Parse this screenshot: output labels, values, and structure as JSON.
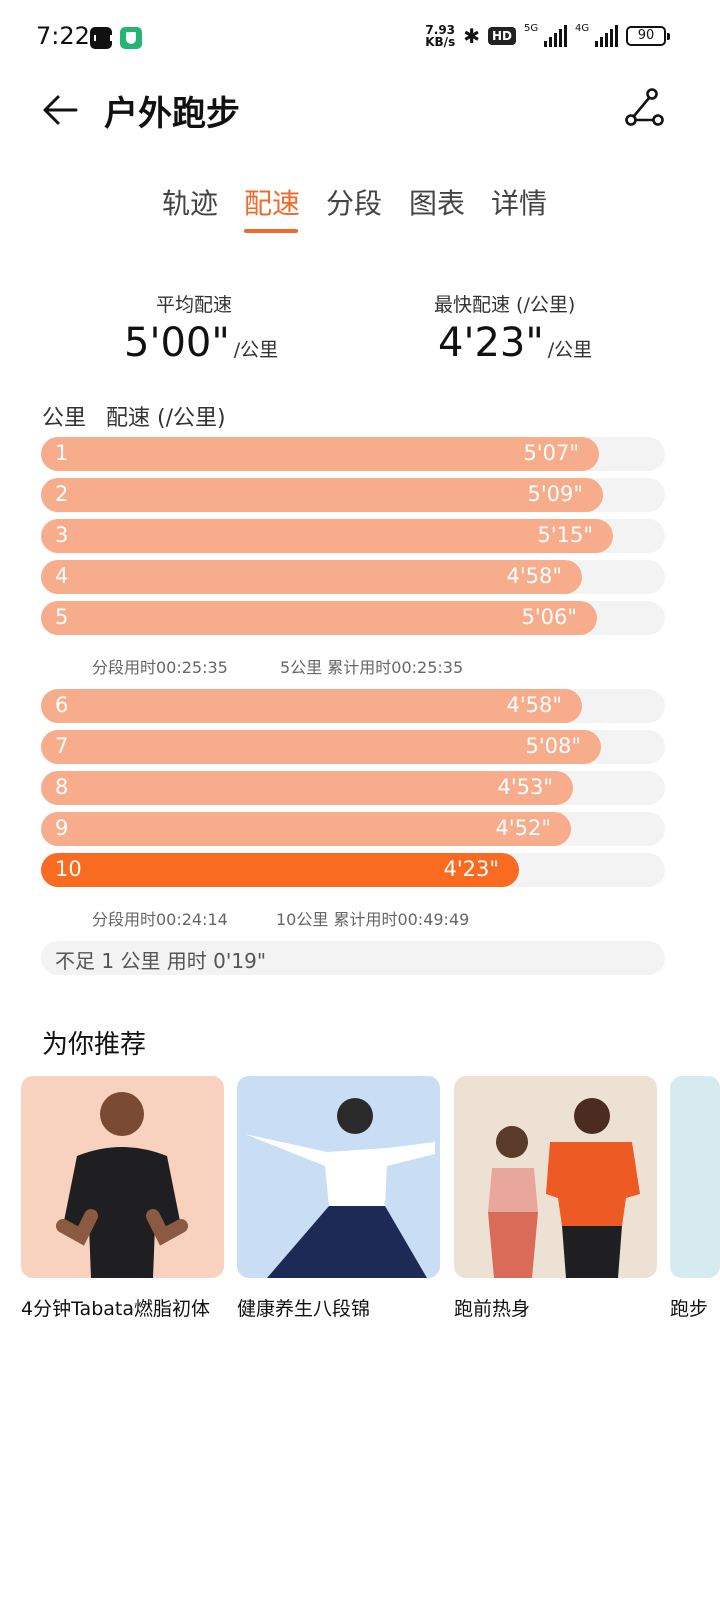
{
  "status_bar": {
    "time": "7:22",
    "net_speed_value": "7.93",
    "net_speed_unit": "KB/s",
    "hd_label": "HD",
    "signal_5g": "5G",
    "signal_4g": "4G",
    "battery": "90"
  },
  "header": {
    "title": "户外跑步",
    "back_icon": "arrow-left-icon",
    "route_icon": "route-icon"
  },
  "tabs": [
    {
      "label": "轨迹",
      "active": false
    },
    {
      "label": "配速",
      "active": true
    },
    {
      "label": "分段",
      "active": false
    },
    {
      "label": "图表",
      "active": false
    },
    {
      "label": "详情",
      "active": false
    }
  ],
  "summary": {
    "avg_label": "平均配速",
    "avg_value": "5'00\"",
    "avg_unit": "/公里",
    "fast_label": "最快配速 (/公里)",
    "fast_value": "4'23\"",
    "fast_unit": "/公里"
  },
  "table_header": {
    "col_km": "公里",
    "col_pace": "配速 (/公里)"
  },
  "splits": [
    {
      "km": "1",
      "pace": "5'07\"",
      "fill": 0.894,
      "fastest": false
    },
    {
      "km": "2",
      "pace": "5'09\"",
      "fill": 0.9,
      "fastest": false
    },
    {
      "km": "3",
      "pace": "5'15\"",
      "fill": 0.917,
      "fastest": false
    },
    {
      "km": "4",
      "pace": "4'58\"",
      "fill": 0.867,
      "fastest": false
    },
    {
      "km": "5",
      "pace": "5'06\"",
      "fill": 0.891,
      "fastest": false
    },
    {
      "km": "6",
      "pace": "4'58\"",
      "fill": 0.867,
      "fastest": false
    },
    {
      "km": "7",
      "pace": "5'08\"",
      "fill": 0.897,
      "fastest": false
    },
    {
      "km": "8",
      "pace": "4'53\"",
      "fill": 0.853,
      "fastest": false
    },
    {
      "km": "9",
      "pace": "4'52\"",
      "fill": 0.85,
      "fastest": false
    },
    {
      "km": "10",
      "pace": "4'23\"",
      "fill": 0.766,
      "fastest": true
    }
  ],
  "split_notes": [
    {
      "segment_time": "分段用时00:25:35",
      "cumulative": "5公里 累计用时00:25:35"
    },
    {
      "segment_time": "分段用时00:24:14",
      "cumulative": "10公里 累计用时00:49:49"
    }
  ],
  "remainder": "不足 1 公里 用时 0'19\"",
  "recommend": {
    "title": "为你推荐",
    "items": [
      {
        "label": "4分钟Tabata燃脂初体",
        "bg": "#f7d1bd"
      },
      {
        "label": "健康养生八段锦",
        "bg": "#c5dcf4"
      },
      {
        "label": "跑前热身",
        "bg": "#ece0d3"
      },
      {
        "label": "跑步",
        "bg": "#d6ebf0"
      }
    ]
  },
  "colors": {
    "accent": "#f06a2b",
    "bar": "#f7ad8c",
    "bar_fastest": "#f96b20",
    "track": "#f3f3f3"
  }
}
